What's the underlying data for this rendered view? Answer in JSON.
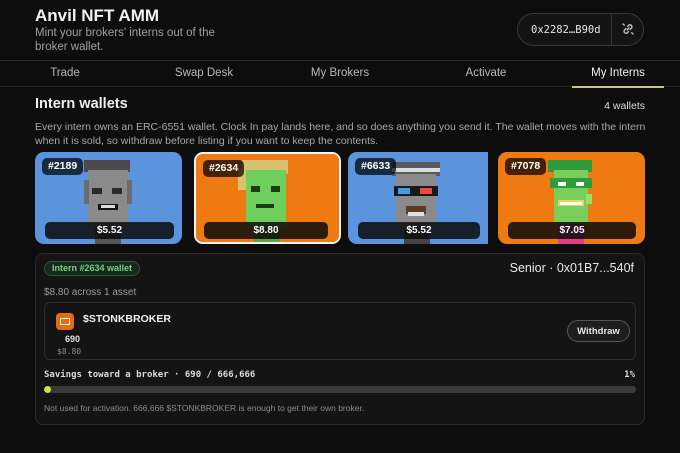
{
  "header": {
    "title": "Anvil NFT AMM",
    "subtitle": "Mint your brokers' interns out of the broker wallet.",
    "wallet_address": "0x2282…B90d",
    "disconnect_icon": "unlink-icon"
  },
  "tabs": [
    {
      "label": "Trade",
      "active": false
    },
    {
      "label": "Swap Desk",
      "active": false
    },
    {
      "label": "My Brokers",
      "active": false
    },
    {
      "label": "Activate",
      "active": false
    },
    {
      "label": "My Interns",
      "active": true
    }
  ],
  "section": {
    "title": "Intern wallets",
    "count": "4 wallets",
    "description": "Every intern owns an ERC-6551 wallet. Clock In pay lands here, and so does anything you send it. The wallet moves with the intern when it is sold, so withdraw before listing if you want to keep the contents."
  },
  "cards": [
    {
      "id": "#2189",
      "price": "$5.52",
      "bg": "#5b94dd",
      "selected": false
    },
    {
      "id": "#2634",
      "price": "$8.80",
      "bg": "#f07a12",
      "selected": true
    },
    {
      "id": "#6633",
      "price": "$5.52",
      "bg": "#5b94dd",
      "selected": false
    },
    {
      "id": "#7078",
      "price": "$7.05",
      "bg": "#f07a12",
      "selected": false
    }
  ],
  "detail": {
    "badge": "Intern #2634 wallet",
    "owner": "Senior · 0x01B7...540f",
    "value_line": "$8.80 across 1 asset",
    "asset": {
      "name": "$STONKBROKER",
      "amount": "690",
      "usd": "$8.80",
      "icon": "briefcase-icon",
      "color": "#e46d14"
    },
    "withdraw_label": "Withdraw",
    "savings_label": "Savings toward a broker · 690 / 666,666",
    "savings_pct": "1%",
    "savings_fraction": 0.001035,
    "note": "Not used for activation. 666,666 $STONKBROKER is enough to get  their own broker."
  },
  "colors": {
    "accent": "#c8e64a",
    "tab_underline": "#c9c58a",
    "badge_green": "#6fd47f"
  }
}
